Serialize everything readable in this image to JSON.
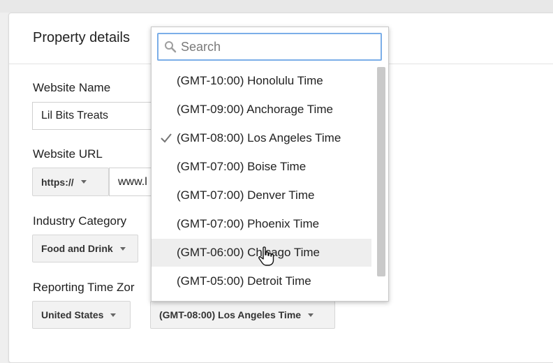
{
  "card": {
    "title": "Property details"
  },
  "form": {
    "website_name": {
      "label": "Website Name",
      "value": "Lil Bits Treats"
    },
    "website_url": {
      "label": "Website URL",
      "protocol": "https://",
      "value": "www.l"
    },
    "industry": {
      "label": "Industry Category",
      "value": "Food and Drink"
    },
    "timezone": {
      "label": "Reporting Time Zor",
      "country": "United States",
      "zone": "(GMT-08:00) Los Angeles Time"
    }
  },
  "dropdown": {
    "search_placeholder": "Search",
    "options": [
      {
        "label": "(GMT-10:00) Honolulu Time",
        "selected": false,
        "hovered": false
      },
      {
        "label": "(GMT-09:00) Anchorage Time",
        "selected": false,
        "hovered": false
      },
      {
        "label": "(GMT-08:00) Los Angeles Time",
        "selected": true,
        "hovered": false
      },
      {
        "label": "(GMT-07:00) Boise Time",
        "selected": false,
        "hovered": false
      },
      {
        "label": "(GMT-07:00) Denver Time",
        "selected": false,
        "hovered": false
      },
      {
        "label": "(GMT-07:00) Phoenix Time",
        "selected": false,
        "hovered": false
      },
      {
        "label": "(GMT-06:00) Chicago Time",
        "selected": false,
        "hovered": true
      },
      {
        "label": "(GMT-05:00) Detroit Time",
        "selected": false,
        "hovered": false
      }
    ]
  },
  "colors": {
    "search_focus_border": "#7baee8",
    "hover_row": "#eeeeee",
    "scrollbar": "#c9c9c9"
  },
  "icons": {
    "search": "search-icon",
    "check": "check-icon",
    "caret": "caret-down-icon",
    "pointer": "hand-pointer-icon"
  }
}
